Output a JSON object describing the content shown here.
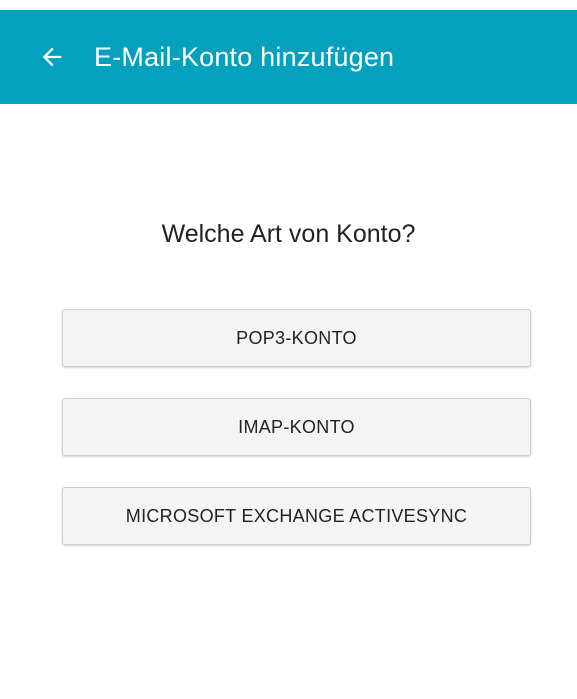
{
  "appbar": {
    "back_icon": "arrow-left-icon",
    "title": "E-Mail-Konto hinzufügen",
    "background_color": "#03a1be"
  },
  "main": {
    "question": "Welche Art von Konto?",
    "options": [
      {
        "label": "POP3-KONTO"
      },
      {
        "label": "IMAP-KONTO"
      },
      {
        "label": "MICROSOFT EXCHANGE ACTIVESYNC"
      }
    ]
  }
}
